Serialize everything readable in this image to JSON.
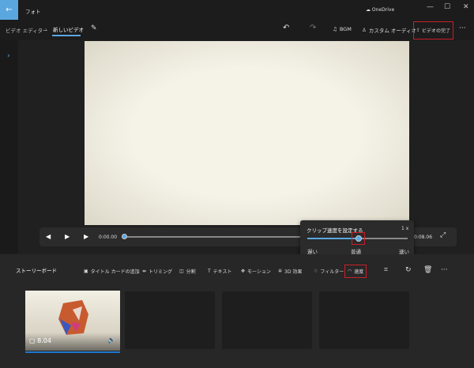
{
  "titlebar": {
    "app_title": "フォト",
    "onedrive": "OneDrive",
    "minimize": "—",
    "maximize": "☐",
    "close": "✕"
  },
  "toolbar": {
    "breadcrumb_parent": "ビデオ エディター",
    "breadcrumb_current": "新しいビデオ",
    "bgm": "BGM",
    "custom_audio": "カスタム オーディオ",
    "finish_video": "ビデオの完了",
    "more": "···"
  },
  "player": {
    "current_time": "0:00.00",
    "total_time": "0:08.06",
    "progress": 0
  },
  "speed_popup": {
    "title": "クリップ速度を設定する",
    "value": "1 x",
    "slow": "遅い",
    "normal": "普通",
    "fast": "速い",
    "level": 0.5
  },
  "storyboard": {
    "title": "ストーリーボード",
    "tools": [
      "タイトル カードの追加",
      "トリミング",
      "分割",
      "テキスト",
      "モーション",
      "3D 効果",
      "フィルター",
      "速度"
    ],
    "more": "···"
  },
  "clips": [
    {
      "duration": "8.04"
    }
  ],
  "colors": {
    "accent": "#5aa7e0",
    "highlight_border": "#c8202a"
  }
}
